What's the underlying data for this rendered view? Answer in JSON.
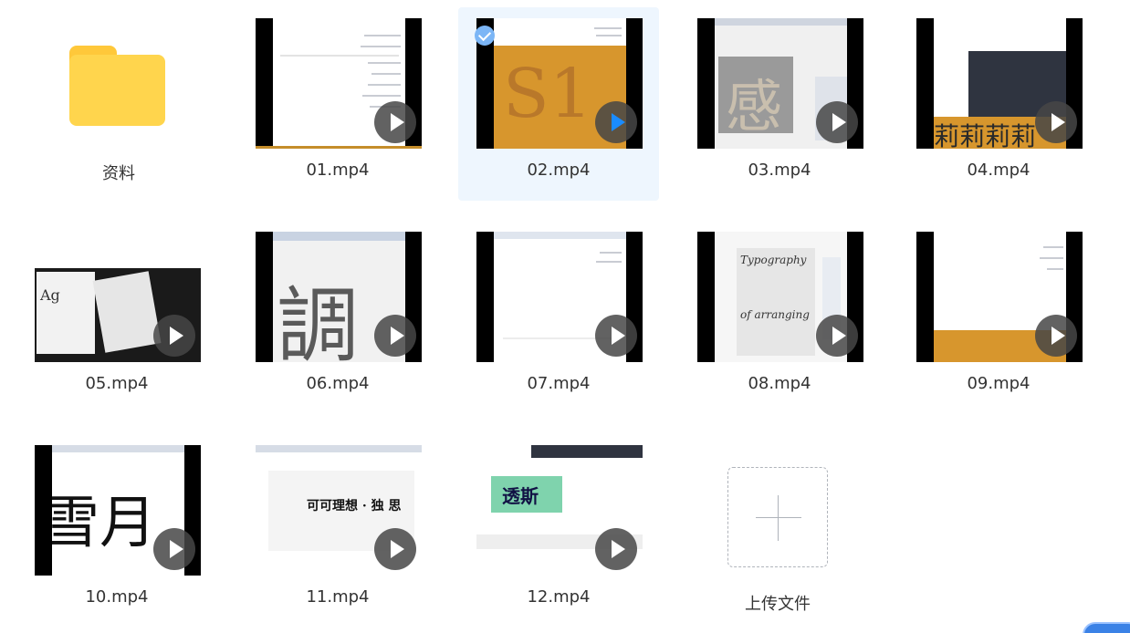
{
  "folder": {
    "label": "资料"
  },
  "videos": [
    {
      "label": "01.mp4"
    },
    {
      "label": "02.mp4"
    },
    {
      "label": "03.mp4"
    },
    {
      "label": "04.mp4"
    },
    {
      "label": "05.mp4"
    },
    {
      "label": "06.mp4"
    },
    {
      "label": "07.mp4"
    },
    {
      "label": "08.mp4"
    },
    {
      "label": "09.mp4"
    },
    {
      "label": "10.mp4"
    },
    {
      "label": "11.mp4"
    },
    {
      "label": "12.mp4"
    }
  ],
  "upload": {
    "label": "上传文件"
  },
  "selected_item": "02.mp4",
  "colors": {
    "folder": "#ffd54d",
    "selection_bg": "#eef6fe",
    "check": "#7cb6f6",
    "play_active": "#1a8cff"
  }
}
